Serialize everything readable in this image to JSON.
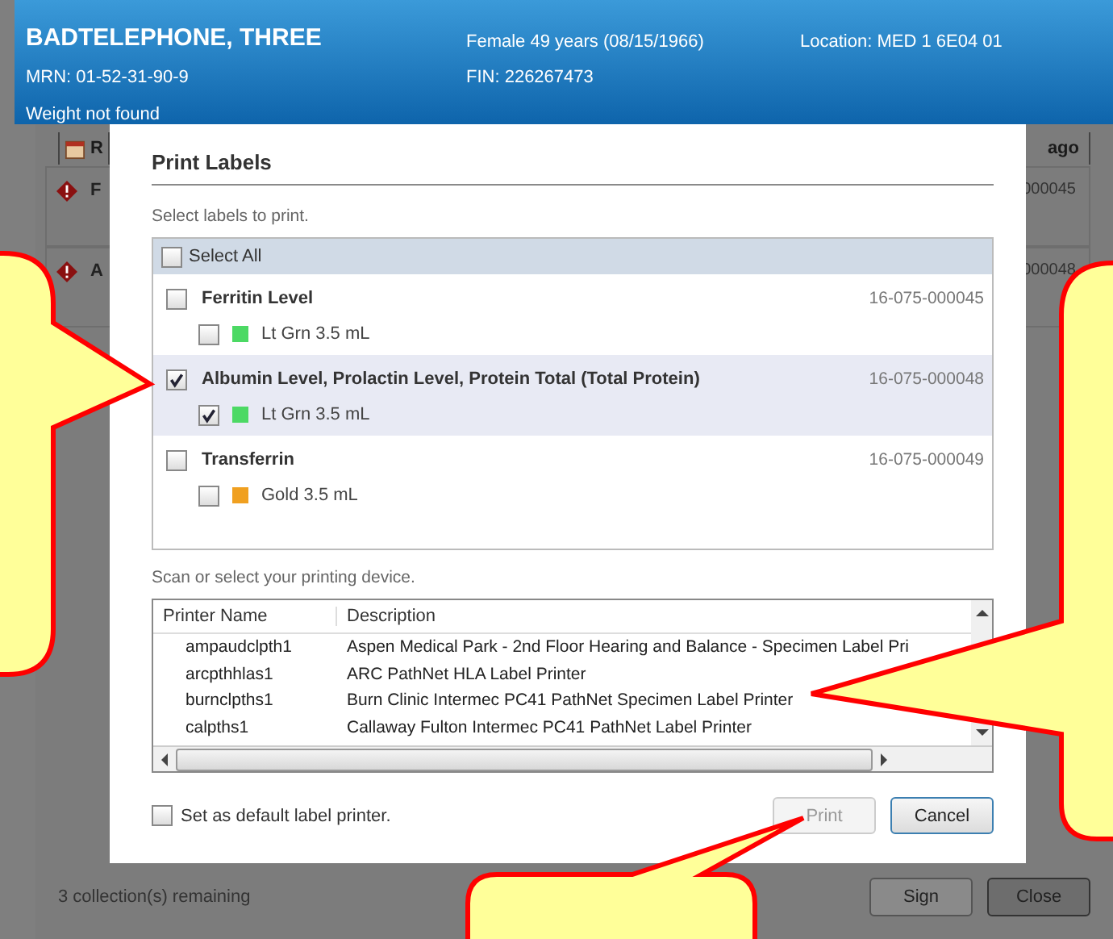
{
  "header": {
    "patient_name": "BADTELEPHONE, THREE",
    "demographics": "Female 49 years (08/15/1966)",
    "location": "Location:  MED 1 6E04 01",
    "mrn": "MRN:  01-52-31-90-9",
    "fin": "FIN:  226267473",
    "weight": "Weight not found"
  },
  "background": {
    "toolbar": [
      "R",
      "ago"
    ],
    "rows": [
      {
        "title": "F",
        "number": "000045"
      },
      {
        "title": "A",
        "number": "000048"
      }
    ],
    "status": "3 collection(s) remaining",
    "buttons": [
      "Sign",
      "Close"
    ]
  },
  "dialog": {
    "title": "Print Labels",
    "instruction": "Select labels to print.",
    "select_all": {
      "label": "Select All",
      "checked": false
    },
    "labels": [
      {
        "name": "Ferritin Level",
        "accession": "16-075-000045",
        "checked": false,
        "selected": false,
        "tubes": [
          {
            "label": "Lt Grn 3.5 mL",
            "color": "#4cd964",
            "checked": false
          }
        ]
      },
      {
        "name": "Albumin Level, Prolactin Level, Protein Total (Total Protein)",
        "accession": "16-075-000048",
        "checked": true,
        "selected": true,
        "tubes": [
          {
            "label": "Lt Grn 3.5 mL",
            "color": "#4cd964",
            "checked": true
          }
        ]
      },
      {
        "name": "Transferrin",
        "accession": "16-075-000049",
        "checked": false,
        "selected": false,
        "tubes": [
          {
            "label": "Gold 3.5 mL",
            "color": "#f0a020",
            "checked": false
          }
        ]
      }
    ],
    "printer_instruction": "Scan or select your printing device.",
    "printer_columns": [
      "Printer Name",
      "Description"
    ],
    "printers": [
      {
        "name": "ampaudclpth1",
        "description": "Aspen Medical Park - 2nd Floor Hearing and Balance - Specimen Label Pri"
      },
      {
        "name": "arcpthhlas1",
        "description": "ARC PathNet HLA Label Printer"
      },
      {
        "name": "burnclpths1",
        "description": "Burn Clinic Intermec PC41 PathNet Specimen Label Printer"
      },
      {
        "name": "calpths1",
        "description": "Callaway Fulton Intermec PC41 PathNet Label Printer"
      }
    ],
    "default_printer": {
      "label": "Set as default label printer.",
      "checked": false
    },
    "buttons": [
      {
        "label": "Print",
        "disabled": true
      },
      {
        "label": "Cancel",
        "disabled": false
      }
    ]
  }
}
